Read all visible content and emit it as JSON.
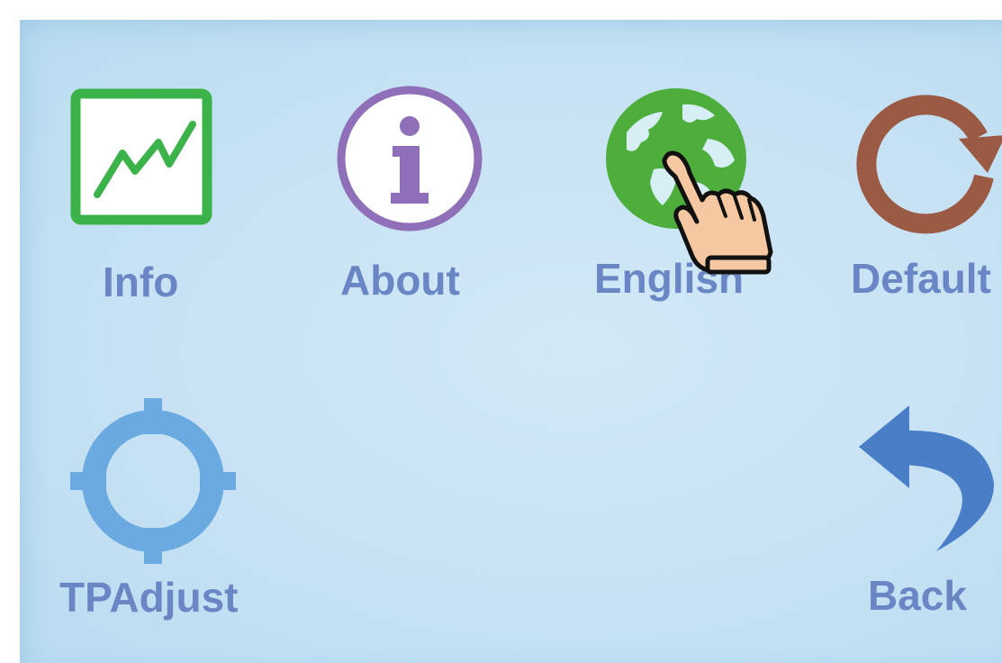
{
  "menu": {
    "items": [
      {
        "id": "info",
        "label": "Info",
        "icon": "chart-line-icon",
        "color": "#3cb34a"
      },
      {
        "id": "about",
        "label": "About",
        "icon": "info-icon",
        "color": "#8e6fb8"
      },
      {
        "id": "english",
        "label": "English",
        "icon": "globe-icon",
        "color": "#4dae3c"
      },
      {
        "id": "default",
        "label": "Default",
        "icon": "refresh-icon",
        "color": "#9b5a43"
      },
      {
        "id": "tpadjust",
        "label": "TPAdjust",
        "icon": "crosshair-icon",
        "color": "#6aaae0"
      },
      {
        "id": "back",
        "label": "Back",
        "icon": "back-arrow-icon",
        "color": "#4a7fc8"
      }
    ]
  },
  "cursor": {
    "icon": "pointing-hand-icon"
  },
  "colors": {
    "background": "#c7e2f4",
    "label": "#6b86c4"
  }
}
